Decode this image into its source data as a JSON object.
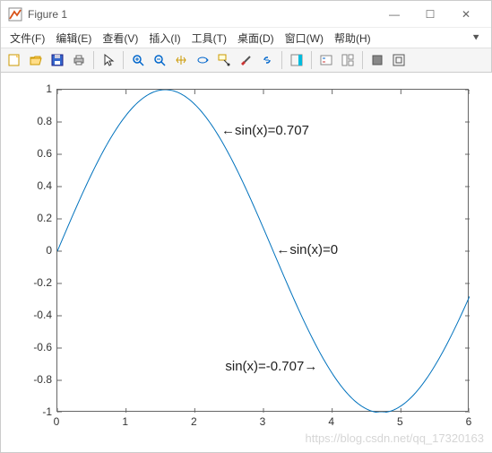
{
  "window": {
    "title": "Figure 1",
    "minimize": "—",
    "maximize": "☐",
    "close": "✕"
  },
  "menu": {
    "file": "文件(F)",
    "edit": "编辑(E)",
    "view": "查看(V)",
    "insert": "插入(I)",
    "tools": "工具(T)",
    "desktop": "桌面(D)",
    "window": "窗口(W)",
    "help": "帮助(H)"
  },
  "toolbar_names": {
    "new": "new-figure-icon",
    "open": "open-icon",
    "save": "save-icon",
    "print": "print-icon",
    "pointer": "pointer-icon",
    "zoomin": "zoom-in-icon",
    "zoomout": "zoom-out-icon",
    "pan": "pan-icon",
    "rotate": "rotate3d-icon",
    "datacursor": "data-cursor-icon",
    "brush": "brush-icon",
    "link": "link-icon",
    "colorbar": "colorbar-icon",
    "legend": "legend-icon",
    "hide": "hide-tools-icon",
    "dock": "dock-icon"
  },
  "chart_data": {
    "type": "line",
    "title": "",
    "xlabel": "",
    "ylabel": "",
    "xlim": [
      0,
      6
    ],
    "ylim": [
      -1,
      1
    ],
    "xticks": [
      0,
      1,
      2,
      3,
      4,
      5,
      6
    ],
    "yticks": [
      -1,
      -0.8,
      -0.6,
      -0.4,
      -0.2,
      0,
      0.2,
      0.4,
      0.6,
      0.8,
      1
    ],
    "series": [
      {
        "name": "sin(x)",
        "color": "#0072BD",
        "function": "sin",
        "x_range": [
          0,
          6
        ],
        "samples": 200
      }
    ],
    "annotations": [
      {
        "text": "←sin(x)=0.707",
        "x": 2.4,
        "y": 0.74,
        "align": "left"
      },
      {
        "text": "←sin(x)=0",
        "x": 3.2,
        "y": 0.0,
        "align": "left"
      },
      {
        "text": "sin(x)=-0.707→",
        "x": 3.8,
        "y": -0.72,
        "align": "right"
      }
    ]
  },
  "watermark": "https://blog.csdn.net/qq_17320163"
}
